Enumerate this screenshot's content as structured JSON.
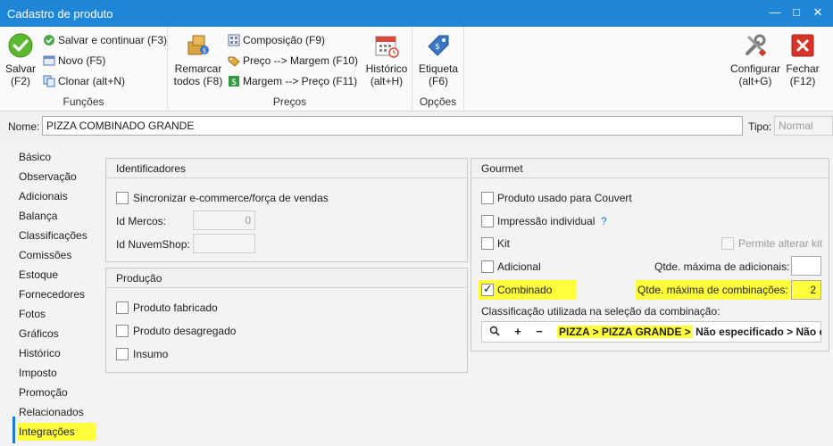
{
  "window": {
    "title": "Cadastro de produto",
    "minimize": "—",
    "maximize": "□",
    "close": "✕"
  },
  "ribbon": {
    "funcoes": {
      "label": "Funções",
      "salvar": {
        "line1": "Salvar",
        "line2": "(F2)",
        "icon": "check-icon"
      },
      "salvar_continuar": "Salvar e continuar (F3)",
      "novo": "Novo (F5)",
      "clonar": "Clonar (alt+N)"
    },
    "precos": {
      "label": "Preços",
      "remarcar": {
        "line1": "Remarcar",
        "line2": "todos (F8)"
      },
      "composicao": "Composição (F9)",
      "preco_margem": "Preço --> Margem (F10)",
      "margem_preco": "Margem --> Preço (F11)",
      "historico": {
        "line1": "Histórico",
        "line2": "(alt+H)"
      }
    },
    "opcoes": {
      "label": "Opções",
      "etiqueta": {
        "line1": "Etiqueta",
        "line2": "(F6)"
      }
    },
    "configurar": {
      "line1": "Configurar",
      "line2": "(alt+G)"
    },
    "fechar": {
      "line1": "Fechar",
      "line2": "(F12)"
    }
  },
  "form": {
    "nome_label": "Nome:",
    "nome_value": "PIZZA COMBINADO GRANDE",
    "tipo_label": "Tipo:",
    "tipo_value": "Normal"
  },
  "sidenav": {
    "items": [
      "Básico",
      "Observação",
      "Adicionais",
      "Balança",
      "Classificações",
      "Comissões",
      "Estoque",
      "Fornecedores",
      "Fotos",
      "Gráficos",
      "Histórico",
      "Imposto",
      "Promoção",
      "Relacionados",
      "Integrações"
    ],
    "active": "Integrações"
  },
  "identificadores": {
    "title": "Identificadores",
    "sincronizar": "Sincronizar e-commerce/força de vendas",
    "id_mercos_label": "Id Mercos:",
    "id_mercos_value": "0",
    "id_nuvemshop_label": "Id NuvemShop:",
    "id_nuvemshop_value": ""
  },
  "producao": {
    "title": "Produção",
    "fabricado": "Produto fabricado",
    "desagregado": "Produto desagregado",
    "insumo": "Insumo"
  },
  "gourmet": {
    "title": "Gourmet",
    "couvert": "Produto usado para Couvert",
    "impressao": "Impressão individual",
    "help": "?",
    "kit": "Kit",
    "permite_alterar_kit": "Permite alterar kit",
    "adicional": "Adicional",
    "qtde_max_adicionais_label": "Qtde. máxima de adicionais:",
    "qtde_max_adicionais_value": "",
    "combinado": "Combinado",
    "combinado_checked": true,
    "qtde_max_combinacoes_label": "Qtde. máxima de combinações:",
    "qtde_max_combinacoes_value": "2",
    "classificacao_label": "Classificação utilizada na seleção da combinação:",
    "path_selected": "PIZZA  > PIZZA GRANDE >",
    "path_rest": " Não especificado > Não e",
    "search_icon": "search-icon",
    "add": "+",
    "remove": "−"
  },
  "colors": {
    "accent": "#1f86d8",
    "highlight": "#ffff3b"
  }
}
